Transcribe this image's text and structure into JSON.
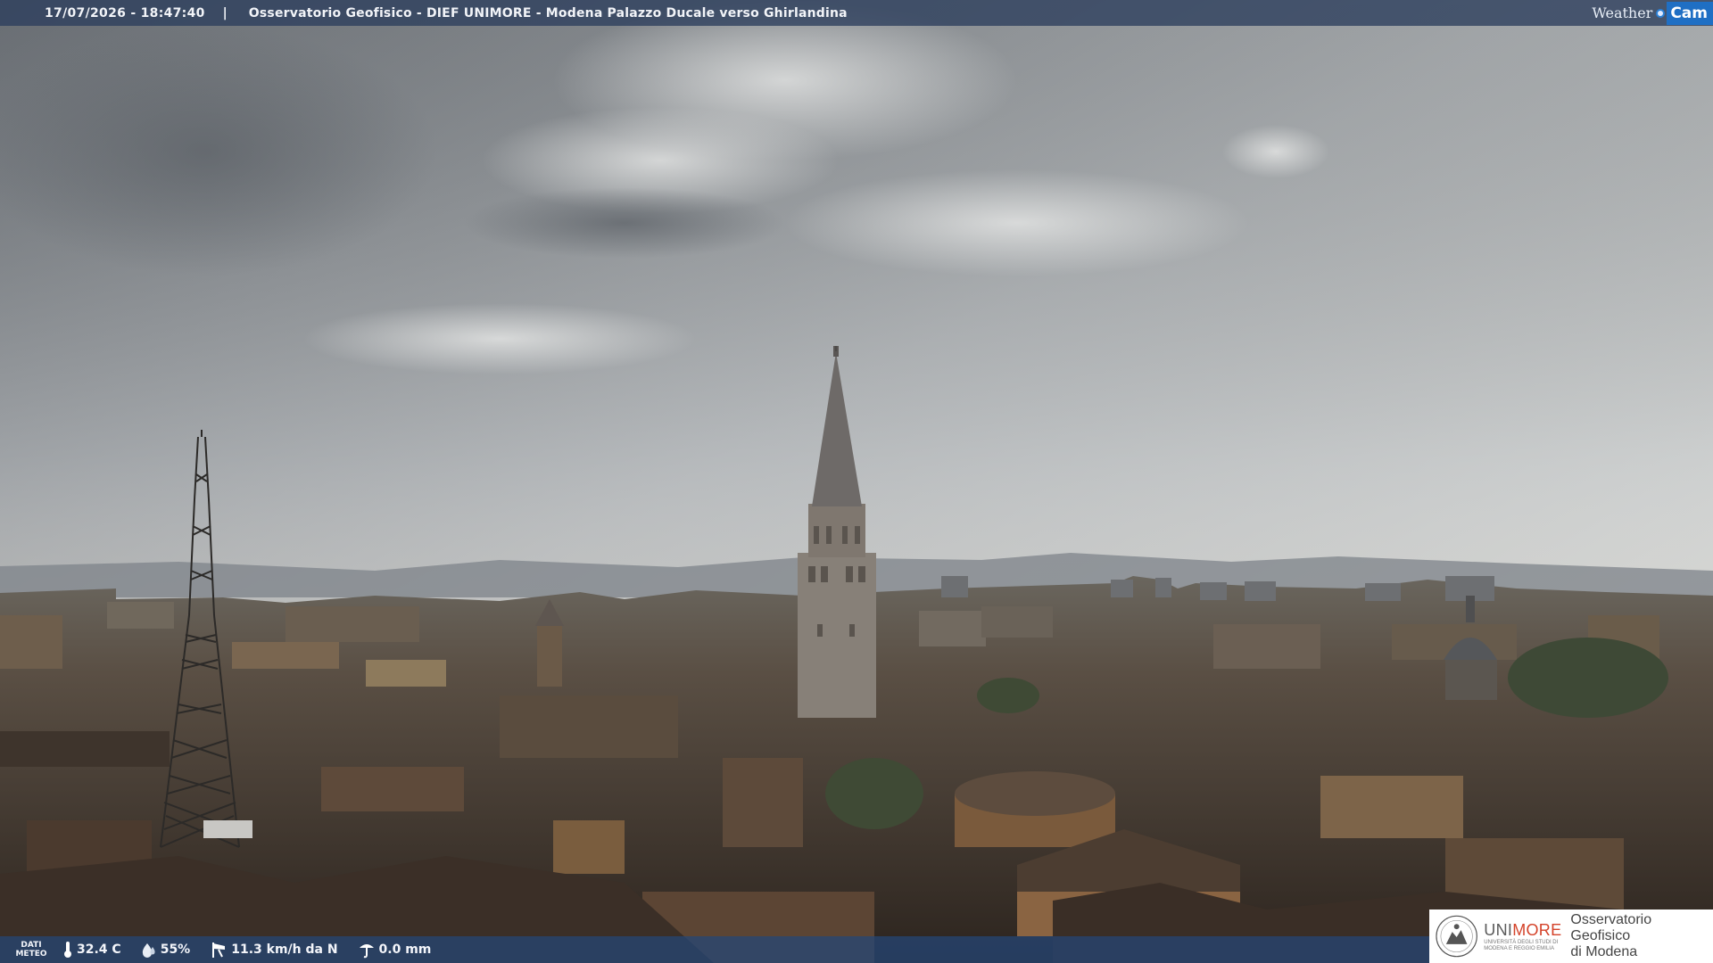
{
  "overlay": {
    "timestamp": "17/07/2026 - 18:47:40",
    "separator": "|",
    "title": "Osservatorio Geofisico - DIEF UNIMORE - Modena Palazzo Ducale verso Ghirlandina"
  },
  "brand": {
    "weather": "Weather",
    "cam": "Cam"
  },
  "weather_bar": {
    "label_line1": "DATI",
    "label_line2": "METEO",
    "temperature": "32.4 C",
    "humidity": "55%",
    "wind": "11.3 km/h da N",
    "rain": "0.0 mm",
    "icons": [
      "thermometer-icon",
      "humidity-drop-icon",
      "wind-sock-icon",
      "rain-gauge-icon"
    ]
  },
  "logo": {
    "uni_prefix": "UNI",
    "uni_suffix": "MORE",
    "uni_sub_line1": "UNIVERSITÀ DEGLI STUDI DI",
    "uni_sub_line2": "MODENA E REGGIO EMILIA",
    "observatory_line1": "Osservatorio Geofisico",
    "observatory_line2": "di Modena"
  },
  "colors": {
    "topbar": "#2c3e5c",
    "bottombar": "#244678",
    "unimore_red": "#d4432a",
    "weathercam_blue": "#1f6fc4"
  }
}
